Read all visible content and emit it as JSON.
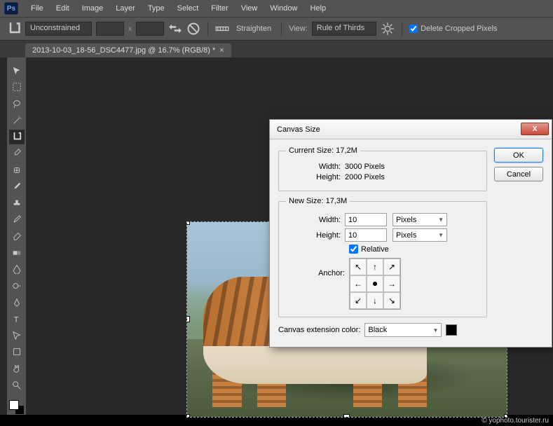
{
  "menu": {
    "items": [
      "File",
      "Edit",
      "Image",
      "Layer",
      "Type",
      "Select",
      "Filter",
      "View",
      "Window",
      "Help"
    ]
  },
  "optbar": {
    "ratio_mode": "Unconstrained",
    "w": "",
    "h": "",
    "straighten": "Straighten",
    "view_label": "View:",
    "view_mode": "Rule of Thirds",
    "delete_cropped": "Delete Cropped Pixels"
  },
  "tab": {
    "title": "2013-10-03_18-56_DSC4477.jpg @ 16.7% (RGB/8) *"
  },
  "dialog": {
    "title": "Canvas Size",
    "ok": "OK",
    "cancel": "Cancel",
    "current_legend": "Current Size: 17,2M",
    "cur_w_label": "Width:",
    "cur_w_val": "3000 Pixels",
    "cur_h_label": "Height:",
    "cur_h_val": "2000 Pixels",
    "new_legend": "New Size: 17,3M",
    "new_w_label": "Width:",
    "new_w_val": "10",
    "new_w_unit": "Pixels",
    "new_h_label": "Height:",
    "new_h_val": "10",
    "new_h_unit": "Pixels",
    "relative": "Relative",
    "anchor_label": "Anchor:",
    "ext_label": "Canvas extension color:",
    "ext_value": "Black"
  },
  "watermark": "© yophoto.tourister.ru"
}
